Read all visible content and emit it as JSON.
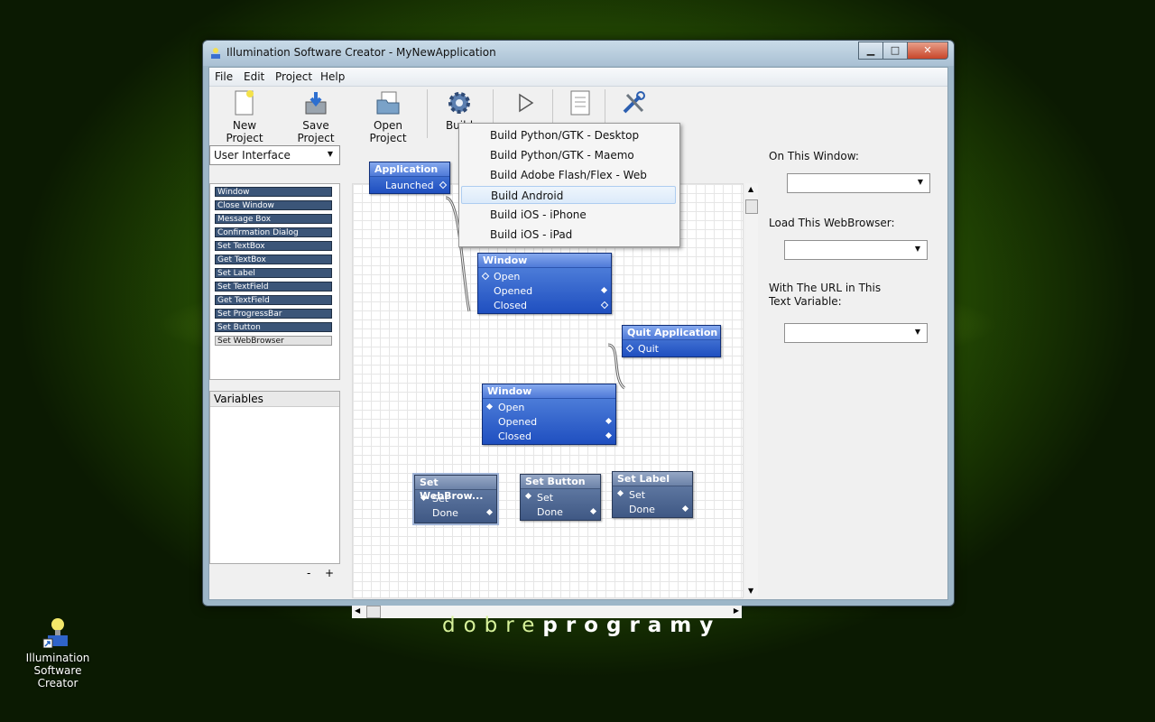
{
  "window": {
    "title": "Illumination Software Creator - MyNewApplication",
    "controls": {
      "minimize": "▁",
      "maximize": "□",
      "close": "✕"
    }
  },
  "menu": [
    "File",
    "Edit",
    "Project",
    "Help"
  ],
  "toolbar": [
    {
      "label": "New Project",
      "icon": "new-document-icon"
    },
    {
      "label": "Save Project",
      "icon": "save-icon"
    },
    {
      "label": "Open Project",
      "icon": "open-folder-icon"
    },
    {
      "label": "Build",
      "icon": "gear-icon"
    },
    {
      "label": "",
      "icon": "play-icon"
    },
    {
      "label": "",
      "icon": "page-icon"
    },
    {
      "label": "",
      "icon": "tools-icon"
    }
  ],
  "category_select": {
    "value": "User Interface"
  },
  "palette": [
    "Window",
    "Close Window",
    "Message Box",
    "Confirmation Dialog",
    "Set TextBox",
    "Get TextBox",
    "Set Label",
    "Set TextField",
    "Get TextField",
    "Set ProgressBar",
    "Set Button",
    "Set WebBrowser"
  ],
  "palette_selected": "Set WebBrowser",
  "variables": {
    "title": "Variables",
    "remove": "-",
    "add": "+"
  },
  "build_menu": [
    "Build Python/GTK - Desktop",
    "Build Python/GTK - Maemo",
    "Build Adobe Flash/Flex - Web",
    "Build Android",
    "Build iOS - iPhone",
    "Build iOS - iPad"
  ],
  "build_menu_highlighted": "Build Android",
  "nodes": {
    "application": {
      "title": "Application",
      "ports": [
        "Launched"
      ]
    },
    "window1": {
      "title": "Window",
      "ports": [
        "Open",
        "Opened",
        "Closed"
      ]
    },
    "quit": {
      "title": "Quit Application",
      "ports": [
        "Quit"
      ]
    },
    "window2": {
      "title": "Window",
      "ports": [
        "Open",
        "Opened",
        "Closed"
      ]
    },
    "set_webbrowser": {
      "title": "Set WebBrow...",
      "ports": [
        "Set",
        "Done"
      ]
    },
    "set_button": {
      "title": "Set Button",
      "ports": [
        "Set",
        "Done"
      ]
    },
    "set_label": {
      "title": "Set Label",
      "ports": [
        "Set",
        "Done"
      ]
    }
  },
  "properties": {
    "on_this_window": "On This Window:",
    "load_webbrowser": "Load This WebBrowser:",
    "with_url": "With The URL in This Text Variable:"
  },
  "desktop": {
    "icon_label": "Illumination Software Creator",
    "watermark_light": "dobre",
    "watermark_bold": "programy"
  },
  "colors": {
    "node_blue": "#2f5fd0",
    "node_grey": "#4e6690",
    "desktop_green": "#5a9a08"
  }
}
